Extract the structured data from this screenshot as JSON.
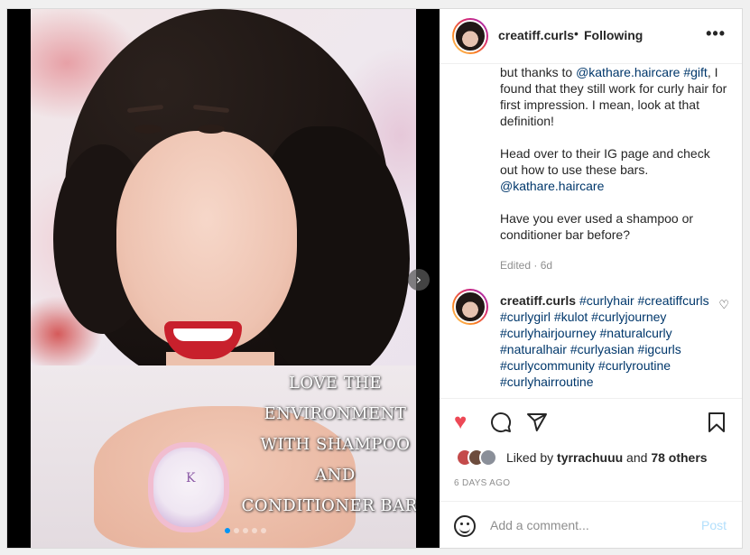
{
  "post": {
    "username": "creatiff.curls",
    "bullet": "•",
    "follow_status": "Following",
    "more_glyph": "•••",
    "overlay_text": [
      "LOVE THE ENVIRONMENT",
      "WITH SHAMPOO AND",
      "CONDITIONER BARS"
    ],
    "jar_logo": "K",
    "carousel": {
      "slides": 5,
      "active": 0
    }
  },
  "caption": {
    "p1_a": "but thanks to ",
    "p1_mention": "@kathare.haircare",
    "p1_space": " ",
    "p1_tag": "#gift",
    "p1_b": ", I found that they still work for curly hair for first impression. I mean, look at that definition!",
    "p2_a": "Head over to their IG page and check out how to use these bars.",
    "p2_mention": "@kathare.haircare",
    "p3": "Have you ever used a shampoo or conditioner bar before?",
    "edited": "Edited · 6d"
  },
  "comment": {
    "username": "creatiff.curls",
    "hashtags": "#curlyhair #creatiffcurls #curlygirl #kulot #curlyjourney #curlyhairjourney #naturalcurly #naturalhair #curlyasian #igcurls #curlycommunity #curlyroutine #curlyhairroutine"
  },
  "actions": {
    "liked_prefix": "Liked by ",
    "liked_user": "tyrrachuuu",
    "liked_mid": " and ",
    "liked_others": "78 others",
    "time": "6 DAYS AGO",
    "add_comment_placeholder": "Add a comment...",
    "post_label": "Post"
  },
  "colors": {
    "like_red": "#ed4956",
    "link_blue": "#00376b",
    "post_disabled": "#b2dffc",
    "carousel_active": "#0095f6"
  },
  "icons": [
    "heart-icon",
    "comment-icon",
    "share-icon",
    "bookmark-icon",
    "emoji-icon",
    "chevron-right-icon",
    "more-icon"
  ]
}
